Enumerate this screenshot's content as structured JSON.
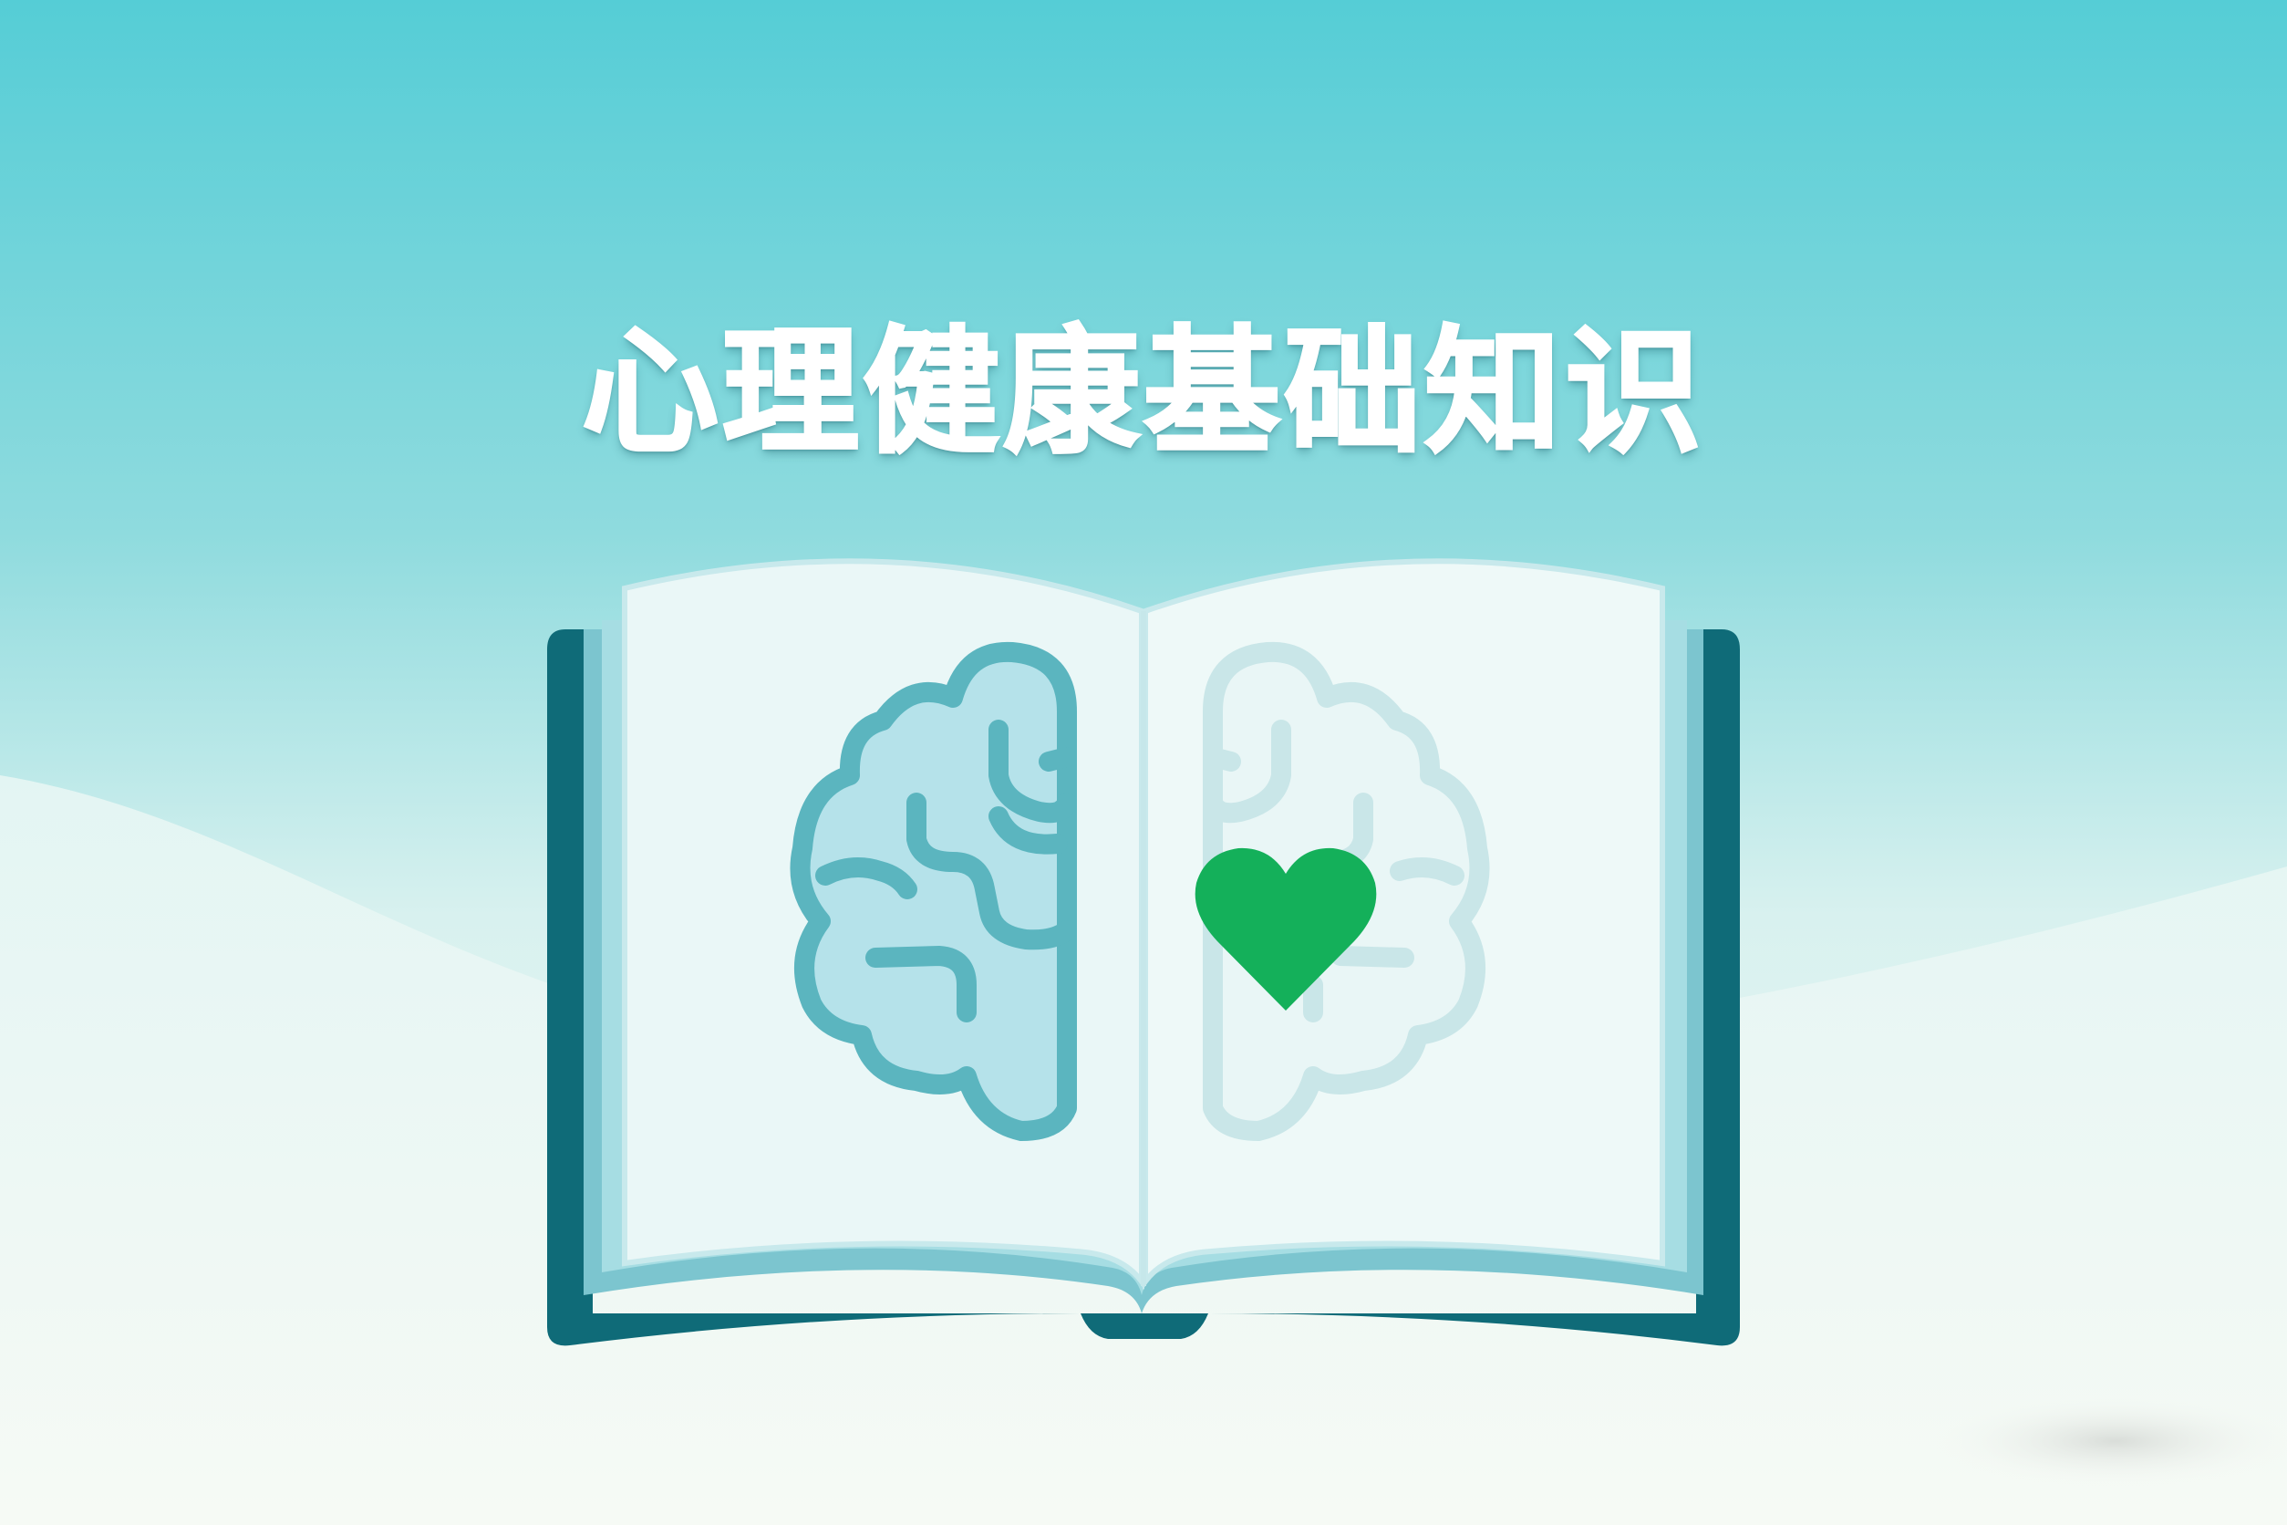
{
  "title": "心理健康基础知识",
  "icons": {
    "book": "open-book-icon",
    "brain": "brain-icon",
    "heart": "heart-icon"
  },
  "colors": {
    "sky_top": "#55cdd6",
    "sky_bottom": "#eef8f5",
    "book_cover": "#0f6b78",
    "brain_outline": "#5bb5bf",
    "heart": "#14b05a",
    "title_text": "#ffffff"
  }
}
